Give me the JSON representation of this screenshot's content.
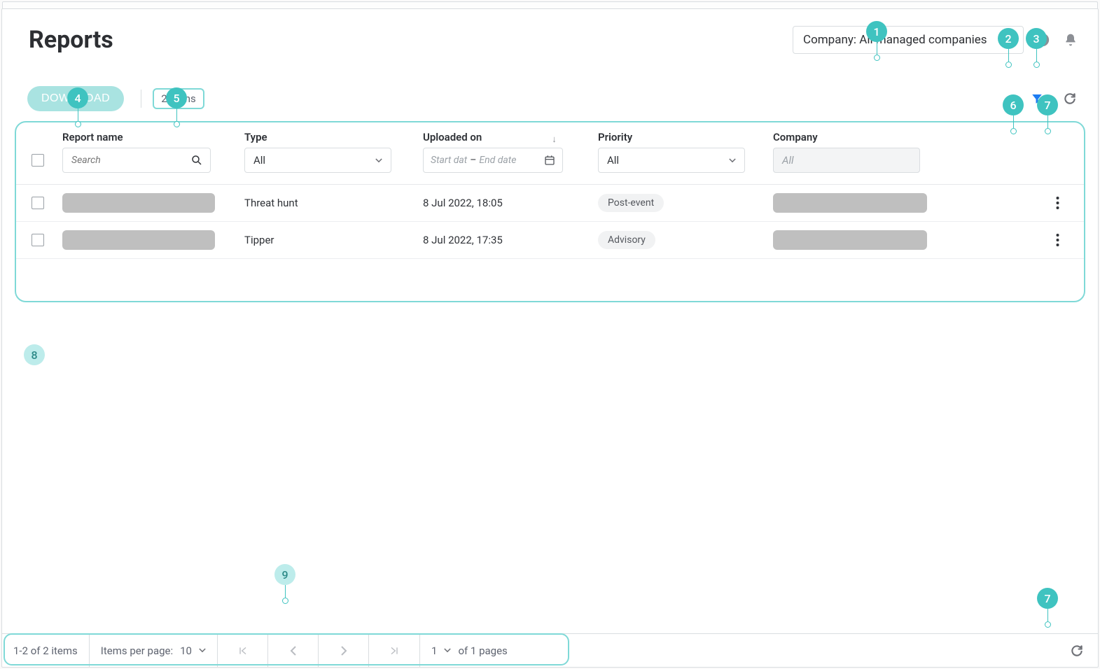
{
  "page": {
    "title": "Reports"
  },
  "header": {
    "company_label": "Company: All managed companies"
  },
  "toolbar": {
    "download": "DOWNLOAD",
    "count_label": "2 items"
  },
  "columns": {
    "report_name": "Report name",
    "type": "Type",
    "uploaded_on": "Uploaded on",
    "priority": "Priority",
    "company": "Company",
    "search_placeholder": "Search",
    "type_value": "All",
    "date_start_placeholder": "Start dat",
    "date_sep": "–",
    "date_end_placeholder": "End date",
    "priority_value": "All",
    "company_value": "All"
  },
  "rows": [
    {
      "type": "Threat hunt",
      "uploaded": "8 Jul 2022, 18:05",
      "priority": "Post-event"
    },
    {
      "type": "Tipper",
      "uploaded": "8 Jul 2022, 17:35",
      "priority": "Advisory"
    }
  ],
  "footer": {
    "range": "1-2 of 2 items",
    "per_page_label": "Items per page:",
    "per_page_value": "10",
    "page_value": "1",
    "of_pages": "of 1 pages"
  },
  "callouts": {
    "1": "1",
    "2": "2",
    "3": "3",
    "4": "4",
    "5": "5",
    "6": "6",
    "7": "7",
    "8": "8",
    "9": "9"
  }
}
